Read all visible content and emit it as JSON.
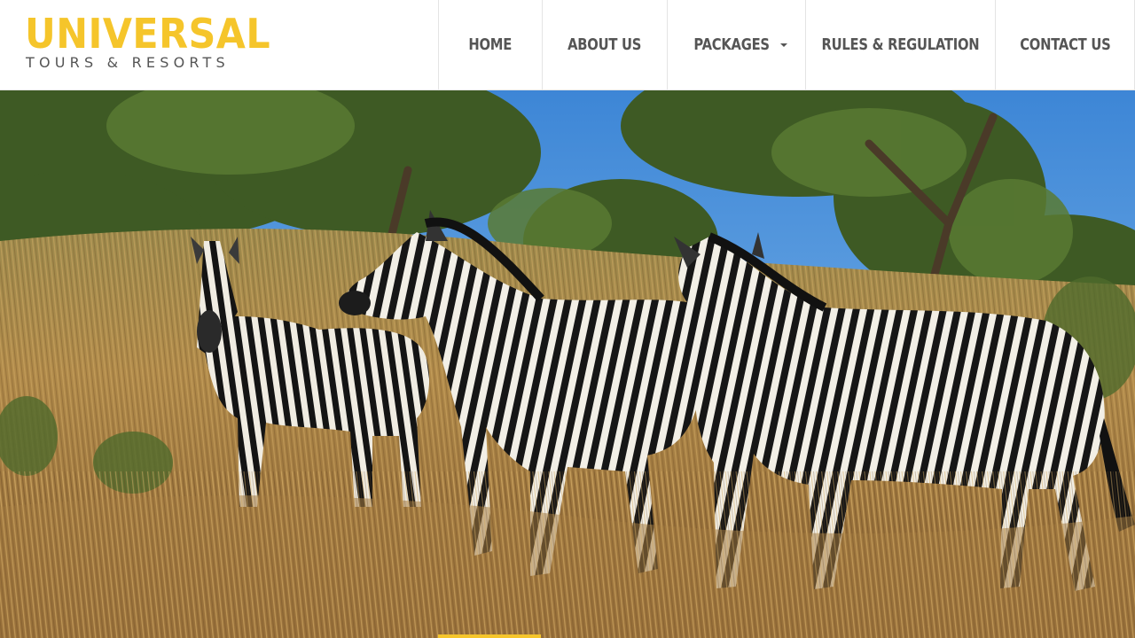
{
  "brand": {
    "name": "UNIVERSAL",
    "tagline": "TOURS & RESORTS"
  },
  "nav": {
    "items": [
      {
        "label": "HOME"
      },
      {
        "label": "ABOUT US"
      },
      {
        "label": "PACKAGES",
        "has_dropdown": true
      },
      {
        "label": "RULES & REGULATION"
      },
      {
        "label": "CONTACT US"
      }
    ]
  },
  "hero": {
    "image": "hero-image-zebras-in-savanna"
  },
  "colors": {
    "accent": "#f5c52b",
    "nav_text": "#555555",
    "sky": "#3f8fd8",
    "grass": "#b08a4a"
  }
}
